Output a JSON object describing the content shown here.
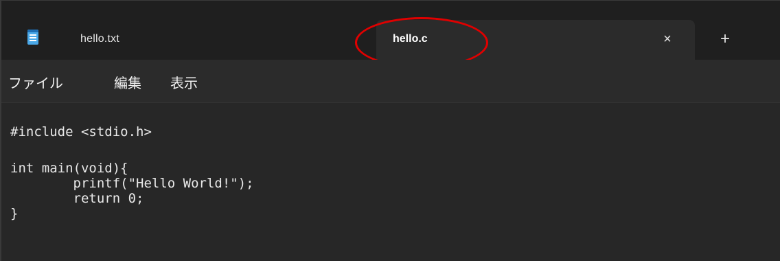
{
  "tabs": [
    {
      "label": "hello.txt",
      "active": false
    },
    {
      "label": "hello.c",
      "active": true
    }
  ],
  "tab_close_icon": "×",
  "new_tab_icon": "+",
  "app_icon": "notepad-icon",
  "menu": {
    "items": [
      {
        "label": "ファイル"
      },
      {
        "label": "編集"
      },
      {
        "label": "表示"
      }
    ]
  },
  "editor": {
    "lines": [
      "#include <stdio.h>",
      "int main(void){",
      "        printf(\"Hello World!\");",
      "        return 0;",
      "}"
    ]
  },
  "colors": {
    "titlebar": "#1f1f1f",
    "active_tab": "#2b2b2b",
    "menubar": "#2b2b2b",
    "editor_bg": "#272727",
    "text": "#e8e8e8",
    "annotation": "#e00000",
    "icon": "#4aa8e8"
  }
}
